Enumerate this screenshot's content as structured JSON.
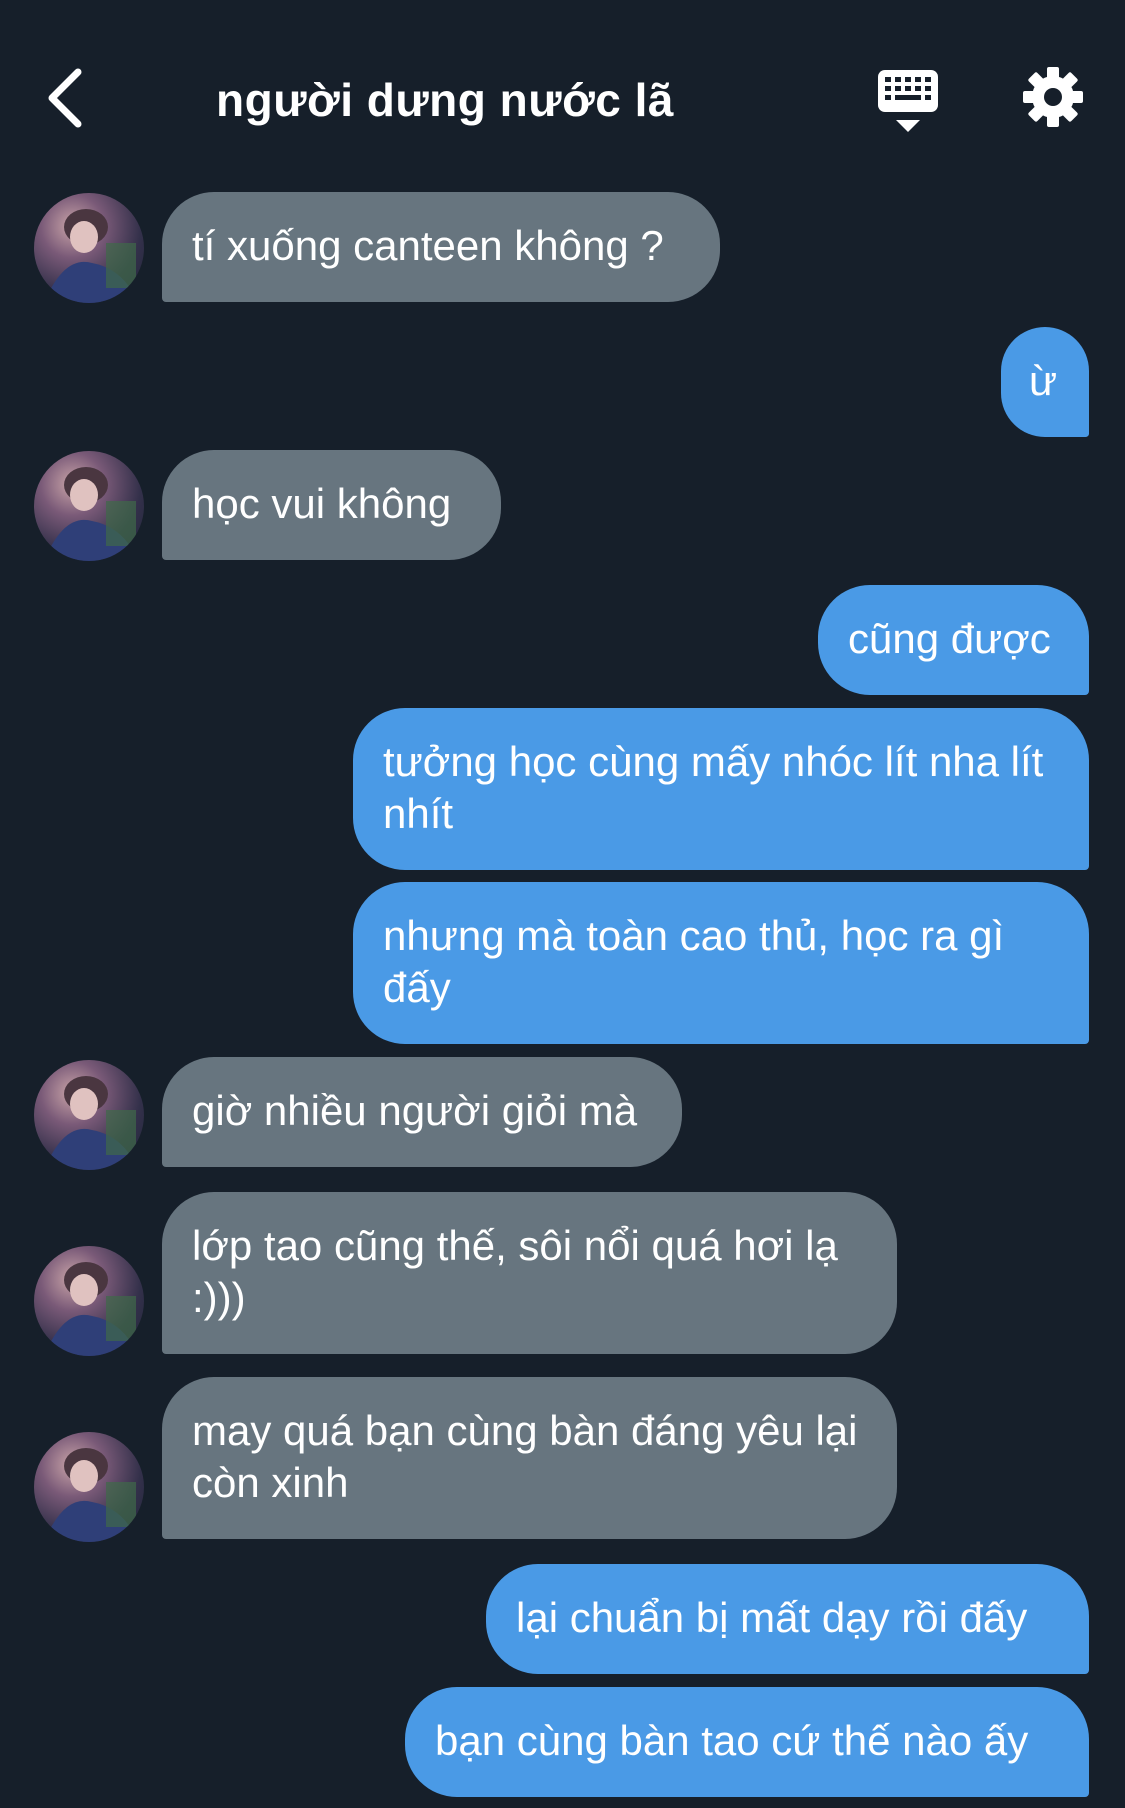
{
  "header": {
    "title": "người dưng nước lã"
  },
  "icons": {
    "back": "chevron-left-icon",
    "keyboard": "keyboard-icon",
    "settings": "gear-icon"
  },
  "colors": {
    "background": "#161f2a",
    "incoming_bubble": "#67757f",
    "outgoing_bubble": "#4a9ae6",
    "text": "#ffffff"
  },
  "messages": [
    {
      "sender": "them",
      "text": "tí xuống canteen không ?"
    },
    {
      "sender": "me",
      "text": "ừ"
    },
    {
      "sender": "them",
      "text": "học vui không"
    },
    {
      "sender": "me",
      "text": "cũng được"
    },
    {
      "sender": "me",
      "text": "tưởng học cùng mấy nhóc lít nha lít nhít"
    },
    {
      "sender": "me",
      "text": "nhưng mà toàn cao thủ, học ra gì đấy"
    },
    {
      "sender": "them",
      "text": "giờ nhiều người giỏi mà"
    },
    {
      "sender": "them",
      "text": "lớp tao cũng thế, sôi nổi quá hơi lạ :)))"
    },
    {
      "sender": "them",
      "text": "may quá bạn cùng bàn đáng yêu lại còn xinh"
    },
    {
      "sender": "me",
      "text": "lại chuẩn bị mất dạy rồi đấy"
    },
    {
      "sender": "me",
      "text": "bạn cùng bàn tao cứ thế nào ấy"
    }
  ]
}
